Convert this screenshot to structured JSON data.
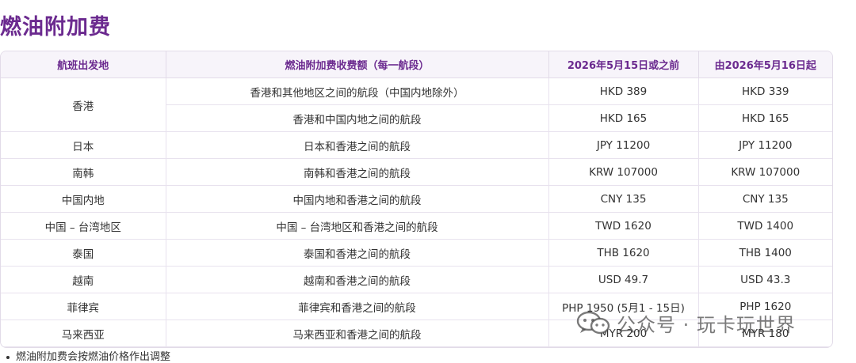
{
  "title": "燃油附加费",
  "table": {
    "headers": [
      "航班出发地",
      "燃油附加费收费额（每一航段）",
      "2026年5月15日或之前",
      "由2026年5月16日起"
    ],
    "rows": [
      {
        "origin": "香港",
        "segment": "香港和其他地区之间的航段（中国内地除外）",
        "before": "HKD 389",
        "after": "HKD 339"
      },
      {
        "origin": "",
        "segment": "香港和中国内地之间的航段",
        "before": "HKD 165",
        "after": "HKD 165"
      },
      {
        "origin": "日本",
        "segment": "日本和香港之间的航段",
        "before": "JPY 11200",
        "after": "JPY 11200"
      },
      {
        "origin": "南韩",
        "segment": "南韩和香港之间的航段",
        "before": "KRW 107000",
        "after": "KRW 107000"
      },
      {
        "origin": "中国内地",
        "segment": "中国内地和香港之间的航段",
        "before": "CNY 135",
        "after": "CNY 135"
      },
      {
        "origin": "中国 – 台湾地区",
        "segment": "中国 – 台湾地区和香港之间的航段",
        "before": "TWD 1620",
        "after": "TWD 1400"
      },
      {
        "origin": "泰国",
        "segment": "泰国和香港之间的航段",
        "before": "THB 1620",
        "after": "THB 1400"
      },
      {
        "origin": "越南",
        "segment": "越南和香港之间的航段",
        "before": "USD 49.7",
        "after": "USD 43.3"
      },
      {
        "origin": "菲律宾",
        "segment": "菲律宾和香港之间的航段",
        "before": "PHP 1950 (5月1 - 15日)",
        "after": "PHP 1620"
      },
      {
        "origin": "马来西亚",
        "segment": "马来西亚和香港之间的航段",
        "before": "MYR 200",
        "after": "MYR 180"
      }
    ]
  },
  "footnote": "燃油附加费会按燃油价格作出调整",
  "watermark": "公众号 · 玩卡玩世界",
  "colors": {
    "accent": "#6b2a8f",
    "header_bg": "#f7f4fa",
    "border": "#e2dbe8"
  },
  "icons": {
    "watermark": "wechat-logo-icon"
  }
}
